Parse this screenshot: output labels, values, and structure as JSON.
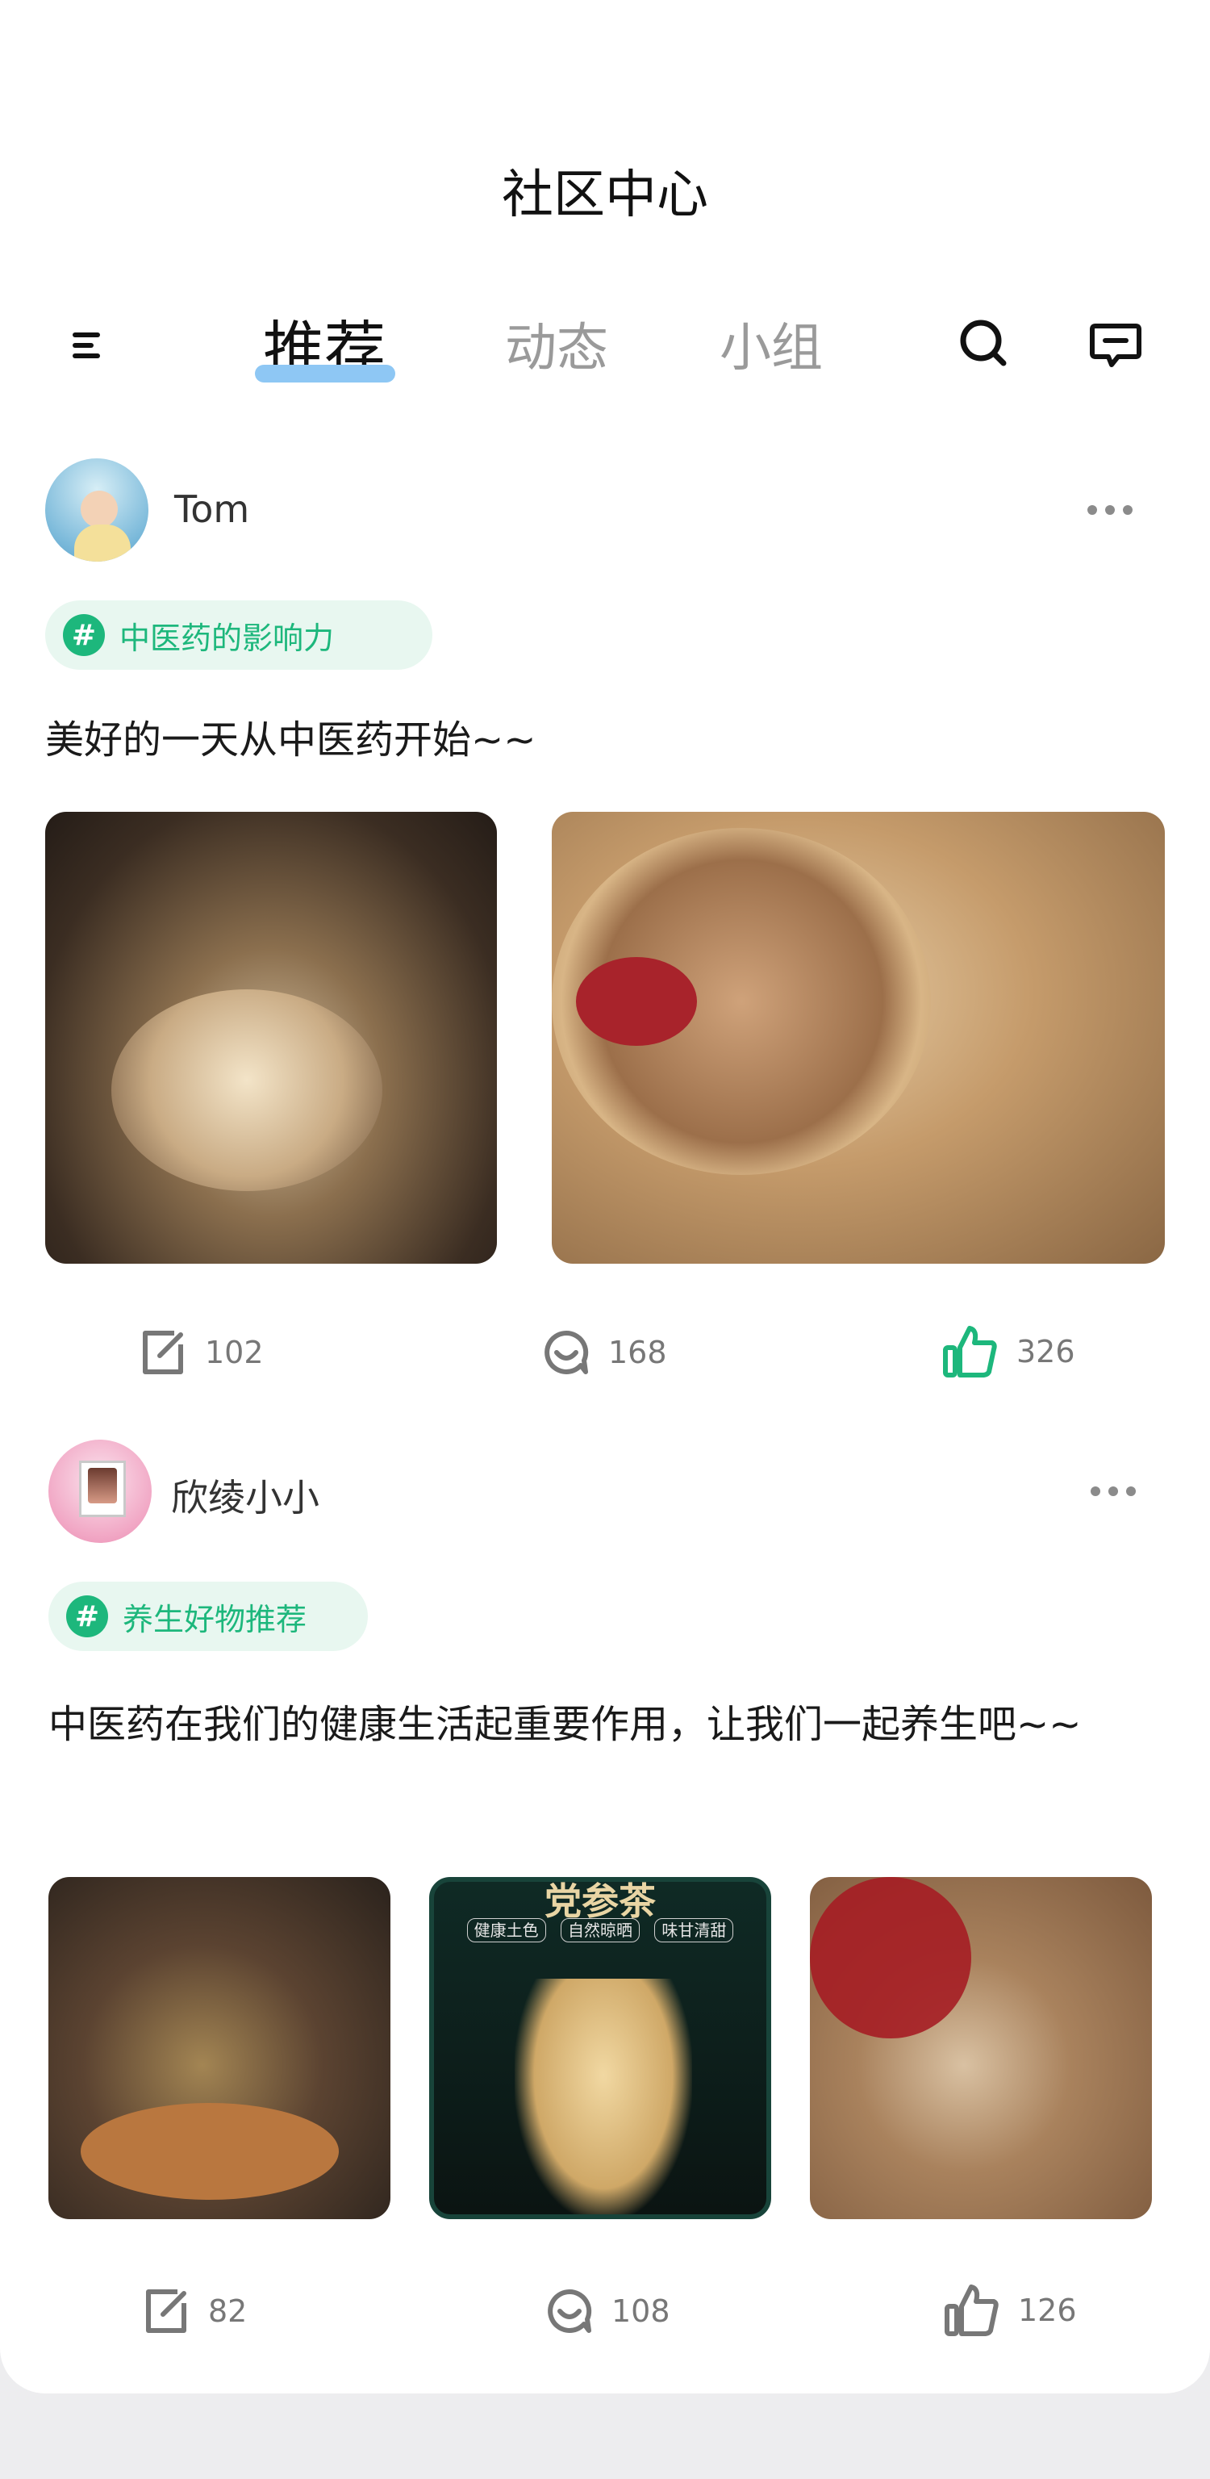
{
  "header": {
    "title": "社区中心"
  },
  "tabs": [
    {
      "label": "推荐",
      "active": true
    },
    {
      "label": "动态",
      "active": false
    },
    {
      "label": "小组",
      "active": false
    }
  ],
  "icons": {
    "menu": "menu-icon",
    "search": "search-icon",
    "message": "message-icon",
    "more": "more-icon",
    "edit": "edit-icon",
    "comment": "comment-icon",
    "like": "thumbs-up-icon"
  },
  "colors": {
    "accent_green": "#1DB77C",
    "tag_bg": "#E8F7F0",
    "tab_underline": "#8EC7F4"
  },
  "posts": [
    {
      "username": "Tom",
      "tag": "中医药的影响力",
      "text": "美好的一天从中医药开始~~",
      "stats": {
        "edit": "102",
        "comments": "168",
        "likes": "326"
      },
      "liked": true
    },
    {
      "username": "欣绫小小",
      "tag": "养生好物推荐",
      "text": "中医药在我们的健康生活起重要作用，让我们一起养生吧~~",
      "image_text": {
        "title": "党参茶",
        "chips": [
          "健康土色",
          "自然晾晒",
          "味甘清甜"
        ]
      },
      "stats": {
        "edit": "82",
        "comments": "108",
        "likes": "126"
      },
      "liked": false
    }
  ]
}
